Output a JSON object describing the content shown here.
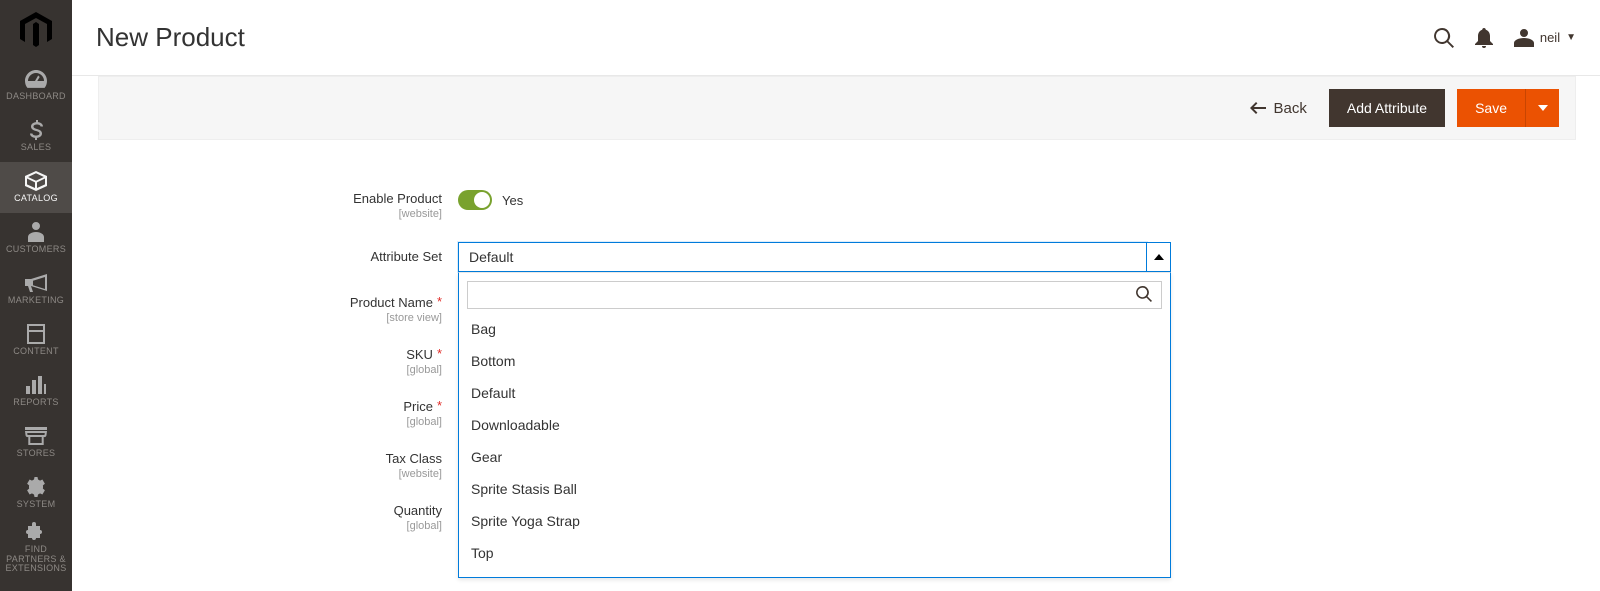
{
  "sidebar": {
    "items": [
      {
        "label": "DASHBOARD"
      },
      {
        "label": "SALES"
      },
      {
        "label": "CATALOG"
      },
      {
        "label": "CUSTOMERS"
      },
      {
        "label": "MARKETING"
      },
      {
        "label": "CONTENT"
      },
      {
        "label": "REPORTS"
      },
      {
        "label": "STORES"
      },
      {
        "label": "SYSTEM"
      },
      {
        "label": "FIND PARTNERS & EXTENSIONS"
      }
    ]
  },
  "header": {
    "title": "New Product",
    "user_name": "neil"
  },
  "actions": {
    "back": "Back",
    "add_attribute": "Add Attribute",
    "save": "Save"
  },
  "form": {
    "enable_product": {
      "label": "Enable Product",
      "scope": "[website]",
      "value_label": "Yes"
    },
    "attribute_set": {
      "label": "Attribute Set",
      "selected": "Default",
      "search_placeholder": "",
      "options": [
        "Bag",
        "Bottom",
        "Default",
        "Downloadable",
        "Gear",
        "Sprite Stasis Ball",
        "Sprite Yoga Strap",
        "Top"
      ]
    },
    "product_name": {
      "label": "Product Name",
      "scope": "[store view]"
    },
    "sku": {
      "label": "SKU",
      "scope": "[global]"
    },
    "price": {
      "label": "Price",
      "scope": "[global]"
    },
    "tax_class": {
      "label": "Tax Class",
      "scope": "[website]"
    },
    "quantity": {
      "label": "Quantity",
      "scope": "[global]"
    }
  }
}
